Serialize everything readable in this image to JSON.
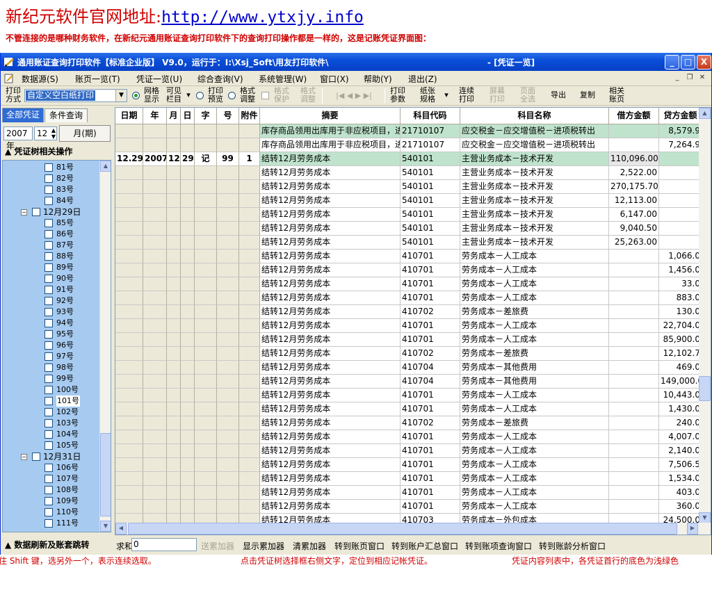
{
  "banner": {
    "title_prefix": "新纪元软件官网地址:",
    "title_url": "http://www.ytxjy.info",
    "subtitle": "不管连接的是哪种财务软件，在新纪元通用账证查询打印软件下的查询打印操作都是一样的，这是记账凭证界面图："
  },
  "window": {
    "title": "通用账证查询打印软件【标准企业版】 V9.0，运行于：I:\\Xsj_Soft\\用友打印软件\\",
    "title_right": "- [凭证一览]",
    "min": "_",
    "max": "□",
    "close": "X"
  },
  "menu": [
    "数据源(S)",
    "账页一览(T)",
    "凭证一览(U)",
    "综合查询(V)",
    "系统管理(W)",
    "窗口(X)",
    "帮助(Y)",
    "退出(Z)"
  ],
  "toolbar": {
    "print_mode_label": "打印\n方式",
    "print_mode_value": "自定义空白纸打印",
    "grid_display": "网格\n显示",
    "visible_cols": "可见\n栏目",
    "print_preview": "打印\n预览",
    "format_adjust": "格式\n调整",
    "format_protect": "格式\n保护",
    "format_adjust2": "格式\n调整",
    "nav": "|◀ ◀ ▶ ▶|",
    "print_params": "打印\n参数",
    "paper_spec": "纸张\n规格",
    "continuous_print": "连续\n打印",
    "screen_print": "屏幕\n打印",
    "page_all_select": "页面\n全选",
    "export": "导出",
    "copy": "复制",
    "related_ledger": "相关\n账页"
  },
  "left": {
    "tab_all": "全部凭证",
    "tab_condition": "条件查询",
    "year": "2007年",
    "month": "12",
    "period_label": "月(期)",
    "tree_header": "凭证树相关操作",
    "tree_items": [
      {
        "label": "81号",
        "level": 2
      },
      {
        "label": "82号",
        "level": 2
      },
      {
        "label": "83号",
        "level": 2
      },
      {
        "label": "84号",
        "level": 2
      },
      {
        "label": "12月29日",
        "level": 1
      },
      {
        "label": "85号",
        "level": 2
      },
      {
        "label": "86号",
        "level": 2
      },
      {
        "label": "87号",
        "level": 2
      },
      {
        "label": "88号",
        "level": 2
      },
      {
        "label": "89号",
        "level": 2
      },
      {
        "label": "90号",
        "level": 2
      },
      {
        "label": "91号",
        "level": 2
      },
      {
        "label": "92号",
        "level": 2
      },
      {
        "label": "93号",
        "level": 2
      },
      {
        "label": "94号",
        "level": 2
      },
      {
        "label": "95号",
        "level": 2
      },
      {
        "label": "96号",
        "level": 2
      },
      {
        "label": "97号",
        "level": 2
      },
      {
        "label": "98号",
        "level": 2
      },
      {
        "label": "99号",
        "level": 2
      },
      {
        "label": "100号",
        "level": 2
      },
      {
        "label": "101号",
        "level": 2,
        "selected": true
      },
      {
        "label": "102号",
        "level": 2
      },
      {
        "label": "103号",
        "level": 2
      },
      {
        "label": "104号",
        "level": 2
      },
      {
        "label": "105号",
        "level": 2
      },
      {
        "label": "12月31日",
        "level": 1
      },
      {
        "label": "106号",
        "level": 2
      },
      {
        "label": "107号",
        "level": 2
      },
      {
        "label": "108号",
        "level": 2
      },
      {
        "label": "109号",
        "level": 2
      },
      {
        "label": "110号",
        "level": 2
      },
      {
        "label": "111号",
        "level": 2
      }
    ]
  },
  "grid": {
    "columns": [
      "日期",
      "年",
      "月",
      "日",
      "字",
      "号",
      "附件",
      "摘要",
      "科目代码",
      "科目名称",
      "借方金额",
      "贷方金额"
    ],
    "rows": [
      {
        "date": "",
        "year": "",
        "month": "",
        "day": "",
        "word": "",
        "no": "",
        "att": "",
        "summary": "库存商品领用出库用于非应税项目，进",
        "code": "21710107",
        "name": "应交税金－应交增值税－进项税转出",
        "debit": "",
        "credit": "8,579.9",
        "hl": "first"
      },
      {
        "date": "",
        "year": "",
        "month": "",
        "day": "",
        "word": "",
        "no": "",
        "att": "",
        "summary": "库存商品领用出库用于非应税项目，进",
        "code": "21710107",
        "name": "应交税金－应交增值税－进项税转出",
        "debit": "",
        "credit": "7,264.9"
      },
      {
        "date": "12.29",
        "year": "2007",
        "month": "12",
        "day": "29",
        "word": "记",
        "no": "99",
        "att": "1",
        "summary": "结转12月劳务成本",
        "code": "540101",
        "name": "主营业务成本－技术开发",
        "debit": "110,096.00",
        "credit": "",
        "hl": "second"
      },
      {
        "summary": "结转12月劳务成本",
        "code": "540101",
        "name": "主营业务成本－技术开发",
        "debit": "2,522.00",
        "credit": ""
      },
      {
        "summary": "结转12月劳务成本",
        "code": "540101",
        "name": "主营业务成本－技术开发",
        "debit": "270,175.70",
        "credit": ""
      },
      {
        "summary": "结转12月劳务成本",
        "code": "540101",
        "name": "主营业务成本－技术开发",
        "debit": "12,113.00",
        "credit": ""
      },
      {
        "summary": "结转12月劳务成本",
        "code": "540101",
        "name": "主营业务成本－技术开发",
        "debit": "6,147.00",
        "credit": ""
      },
      {
        "summary": "结转12月劳务成本",
        "code": "540101",
        "name": "主营业务成本－技术开发",
        "debit": "9,040.50",
        "credit": ""
      },
      {
        "summary": "结转12月劳务成本",
        "code": "540101",
        "name": "主营业务成本－技术开发",
        "debit": "25,263.00",
        "credit": ""
      },
      {
        "summary": "结转12月劳务成本",
        "code": "410701",
        "name": "劳务成本－人工成本",
        "debit": "",
        "credit": "1,066.0"
      },
      {
        "summary": "结转12月劳务成本",
        "code": "410701",
        "name": "劳务成本－人工成本",
        "debit": "",
        "credit": "1,456.0"
      },
      {
        "summary": "结转12月劳务成本",
        "code": "410701",
        "name": "劳务成本－人工成本",
        "debit": "",
        "credit": "33.0"
      },
      {
        "summary": "结转12月劳务成本",
        "code": "410701",
        "name": "劳务成本－人工成本",
        "debit": "",
        "credit": "883.0"
      },
      {
        "summary": "结转12月劳务成本",
        "code": "410702",
        "name": "劳务成本－差旅费",
        "debit": "",
        "credit": "130.0"
      },
      {
        "summary": "结转12月劳务成本",
        "code": "410701",
        "name": "劳务成本－人工成本",
        "debit": "",
        "credit": "22,704.0"
      },
      {
        "summary": "结转12月劳务成本",
        "code": "410701",
        "name": "劳务成本－人工成本",
        "debit": "",
        "credit": "85,900.0"
      },
      {
        "summary": "结转12月劳务成本",
        "code": "410702",
        "name": "劳务成本－差旅费",
        "debit": "",
        "credit": "12,102.7"
      },
      {
        "summary": "结转12月劳务成本",
        "code": "410704",
        "name": "劳务成本－其他费用",
        "debit": "",
        "credit": "469.0"
      },
      {
        "summary": "结转12月劳务成本",
        "code": "410704",
        "name": "劳务成本－其他费用",
        "debit": "",
        "credit": "149,000.0"
      },
      {
        "summary": "结转12月劳务成本",
        "code": "410701",
        "name": "劳务成本－人工成本",
        "debit": "",
        "credit": "10,443.0"
      },
      {
        "summary": "结转12月劳务成本",
        "code": "410701",
        "name": "劳务成本－人工成本",
        "debit": "",
        "credit": "1,430.0"
      },
      {
        "summary": "结转12月劳务成本",
        "code": "410702",
        "name": "劳务成本－差旅费",
        "debit": "",
        "credit": "240.0"
      },
      {
        "summary": "结转12月劳务成本",
        "code": "410701",
        "name": "劳务成本－人工成本",
        "debit": "",
        "credit": "4,007.0"
      },
      {
        "summary": "结转12月劳务成本",
        "code": "410701",
        "name": "劳务成本－人工成本",
        "debit": "",
        "credit": "2,140.0"
      },
      {
        "summary": "结转12月劳务成本",
        "code": "410701",
        "name": "劳务成本－人工成本",
        "debit": "",
        "credit": "7,506.5"
      },
      {
        "summary": "结转12月劳务成本",
        "code": "410701",
        "name": "劳务成本－人工成本",
        "debit": "",
        "credit": "1,534.0"
      },
      {
        "summary": "结转12月劳务成本",
        "code": "410701",
        "name": "劳务成本－人工成本",
        "debit": "",
        "credit": "403.0"
      },
      {
        "summary": "结转12月劳务成本",
        "code": "410701",
        "name": "劳务成本－人工成本",
        "debit": "",
        "credit": "360.0"
      },
      {
        "summary": "结转12月劳务成本",
        "code": "410703",
        "name": "劳务成本－外包成本",
        "debit": "",
        "credit": "24,500.0"
      }
    ]
  },
  "bottom": {
    "refresh": "数据刷新及账套跳转",
    "sum_label": "求和",
    "sum_value": "0",
    "buttons": [
      {
        "label": "送累加器",
        "disabled": true
      },
      {
        "label": "显示累加器"
      },
      {
        "label": "清累加器"
      },
      {
        "label": "转到账页窗口"
      },
      {
        "label": "转到账户汇总窗口"
      },
      {
        "label": "转到账项查询窗口"
      },
      {
        "label": "转到账龄分析窗口"
      }
    ]
  },
  "help": {
    "part1": "住 Shift 键，选另外一个，表示连续选取。",
    "part2": "点击凭证树选择框右侧文字，定位到相应记帐凭证。",
    "part3": "凭证内容列表中，各凭证首行的底色为浅绿色"
  },
  "colors": {
    "title_red": "#d00000",
    "url_blue": "#0000cc",
    "titlebar_blue": "#0a4fd8",
    "tree_bg": "#a6caf0",
    "highlight_green": "#bfe3cc"
  }
}
